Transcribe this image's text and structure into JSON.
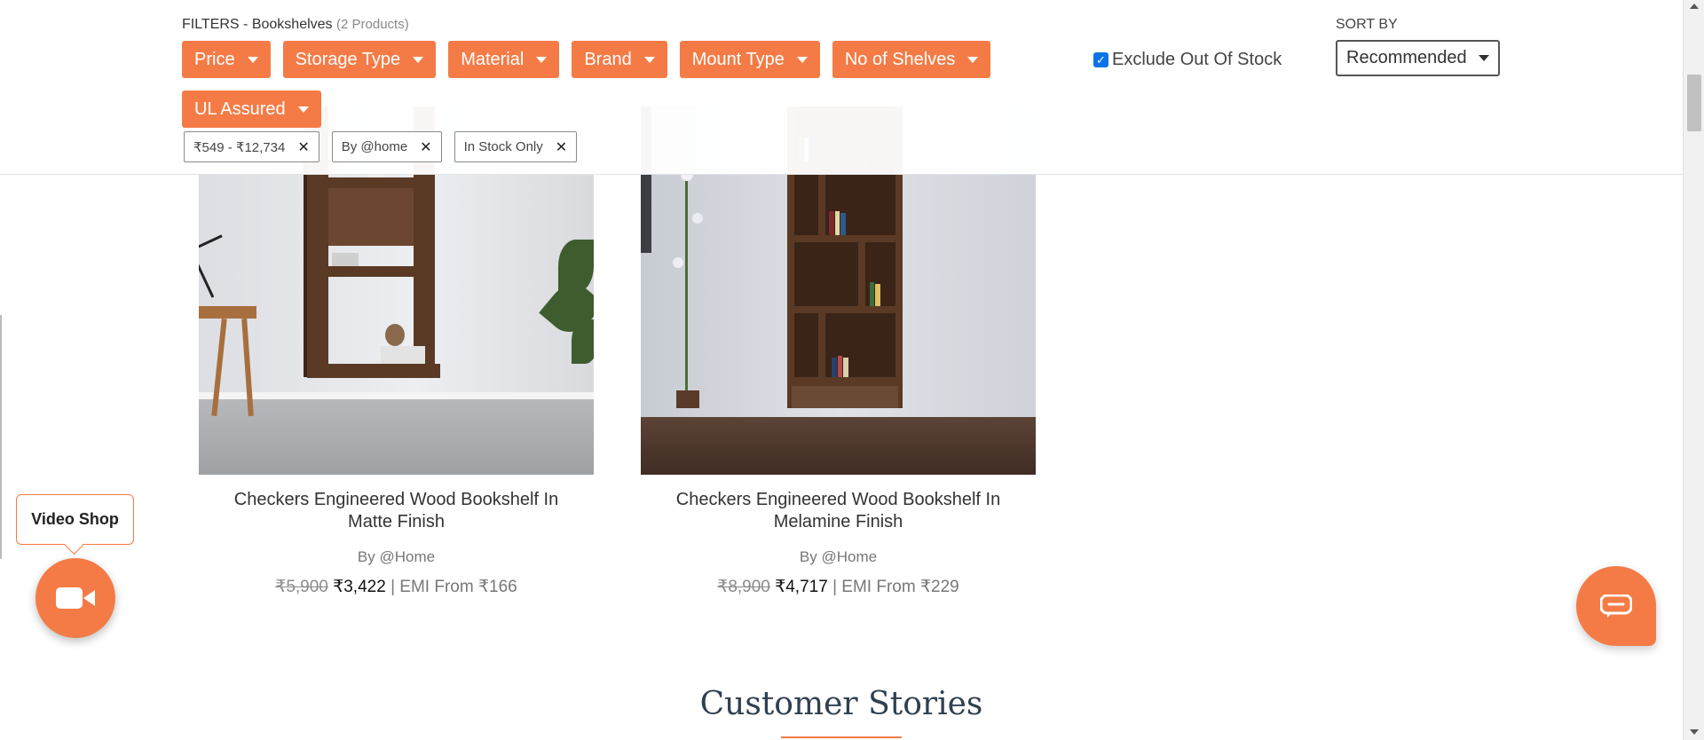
{
  "filters": {
    "title": "FILTERS - Bookshelves",
    "count": "(2 Products)",
    "chips": [
      "Price",
      "Storage Type",
      "Material",
      "Brand",
      "Mount Type",
      "No of Shelves",
      "UL Assured"
    ],
    "applied": [
      "₹549 - ₹12,734",
      "By @home",
      "In Stock Only"
    ],
    "exclude_out_of_stock_label": "Exclude Out Of Stock",
    "exclude_out_of_stock_checked": true
  },
  "sort": {
    "label": "SORT BY",
    "value": "Recommended"
  },
  "products": [
    {
      "name": "Checkers Engineered Wood Bookshelf In Matte Finish",
      "brand": "By @Home",
      "old_price": "₹5,900",
      "price": "₹3,422",
      "emi": "| EMI From ₹166"
    },
    {
      "name": "Checkers Engineered Wood Bookshelf In Melamine Finish",
      "brand": "By @Home",
      "old_price": "₹8,900",
      "price": "₹4,717",
      "emi": "| EMI From ₹229"
    }
  ],
  "section": {
    "customer_stories": "Customer Stories"
  },
  "widgets": {
    "video_shop": "Video Shop"
  },
  "colors": {
    "accent": "#f47b46",
    "checkbox": "#0b73e8"
  }
}
